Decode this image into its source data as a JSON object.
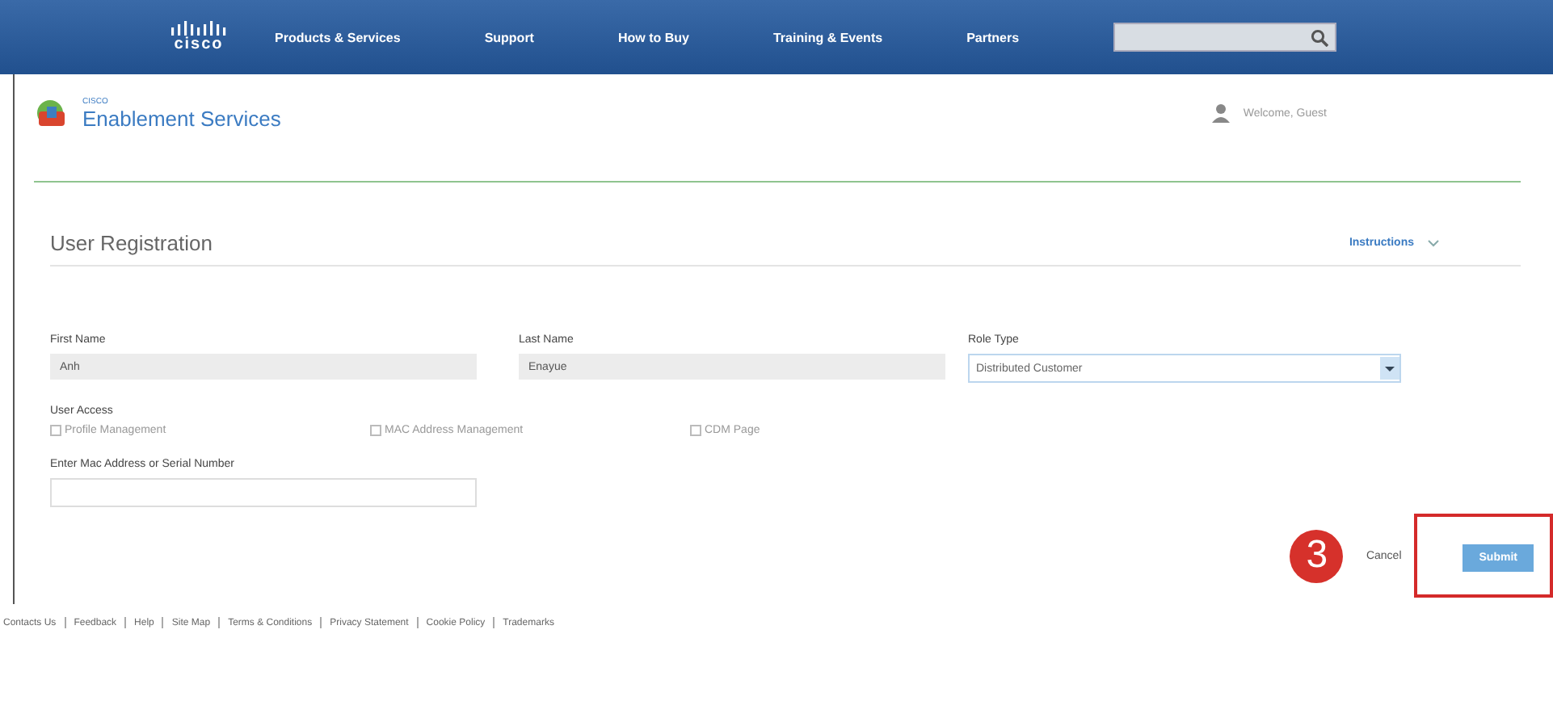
{
  "nav": {
    "logo": "cisco",
    "items": [
      "Products & Services",
      "Support",
      "How to Buy",
      "Training & Events",
      "Partners"
    ]
  },
  "header": {
    "brand_small": "CISCO",
    "brand": "Enablement Services",
    "user": "Welcome, Guest"
  },
  "form": {
    "title": "User Registration",
    "instructions": "Instructions",
    "fields": [
      {
        "label": "First Name",
        "value": "Anh",
        "kind": "readonly"
      },
      {
        "label": "Last Name",
        "value": "Enayue",
        "kind": "readonly"
      },
      {
        "label": "Role Type",
        "value": "Distributed Customer",
        "kind": "select"
      }
    ],
    "access_label": "User Access",
    "access": [
      {
        "label": "Profile Management",
        "checked": false
      },
      {
        "label": "MAC Address Management",
        "checked": false
      },
      {
        "label": "CDM Page",
        "checked": false
      }
    ],
    "mac_label": "Enter Mac Address or Serial Number",
    "buttons": [
      {
        "label": "Cancel",
        "kind": "link"
      },
      {
        "label": "Submit",
        "kind": "primary"
      }
    ]
  },
  "annotation": {
    "step": "3"
  },
  "footer": [
    "Contacts Us",
    "Feedback",
    "Help",
    "Site Map",
    "Terms & Conditions",
    "Privacy Statement",
    "Cookie Policy",
    "Trademarks"
  ]
}
